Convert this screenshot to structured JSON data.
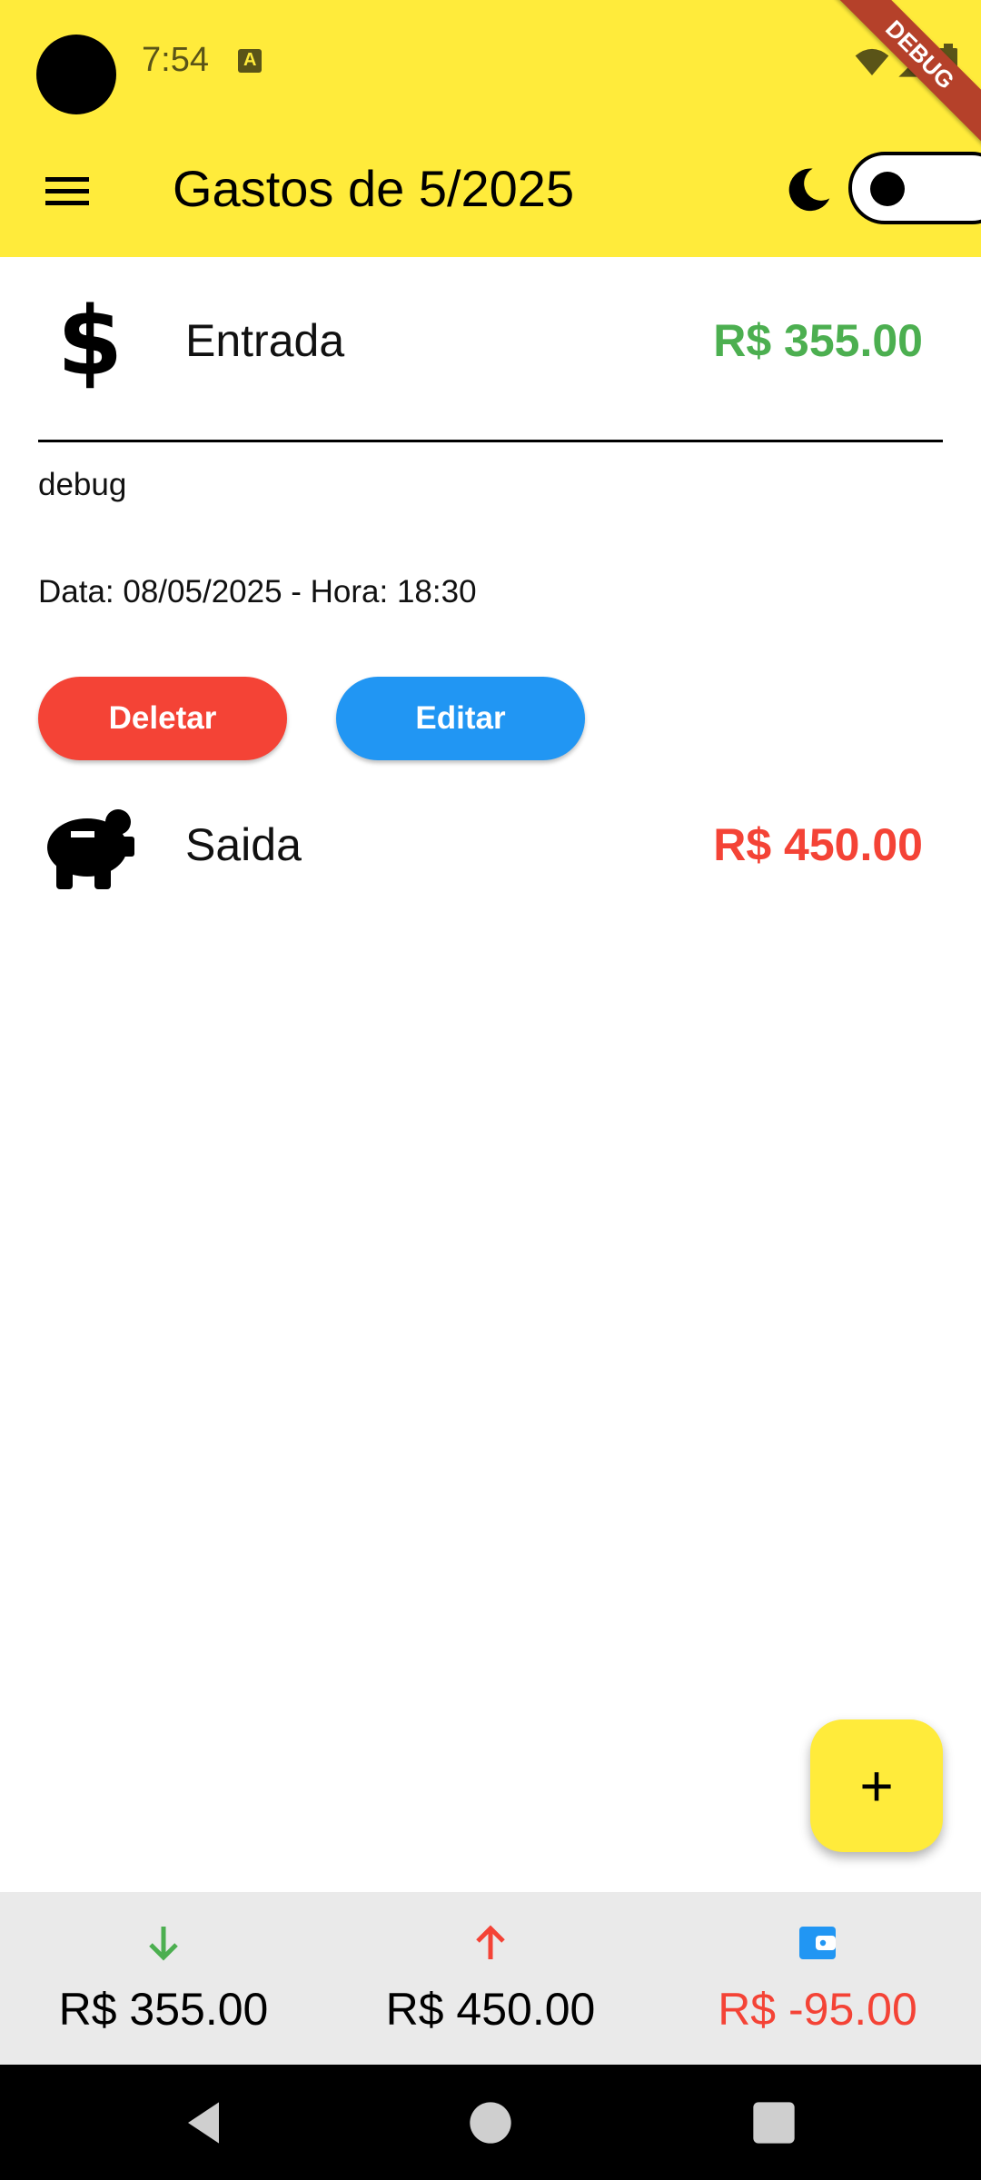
{
  "status_bar": {
    "time": "7:54",
    "debug_label": "DEBUG"
  },
  "app_bar": {
    "title": "Gastos de 5/2025",
    "theme_toggle_on": false
  },
  "transactions": [
    {
      "label": "Entrada",
      "value": "R$ 355.00",
      "icon": "dollar-icon",
      "color": "#4CAF50",
      "expanded": true,
      "description": "debug",
      "datetime": "Data: 08/05/2025 - Hora: 18:30",
      "delete_label": "Deletar",
      "edit_label": "Editar"
    },
    {
      "label": "Saida",
      "value": "R$ 450.00",
      "icon": "piggy-bank-icon",
      "color": "#F44336",
      "expanded": false
    }
  ],
  "fab": {
    "label": "+"
  },
  "summary": {
    "income": {
      "value": "R$ 355.00",
      "icon": "arrow-down-icon",
      "color": "#4CAF50"
    },
    "expense": {
      "value": "R$ 450.00",
      "icon": "arrow-up-icon",
      "color": "#F44336"
    },
    "balance": {
      "value": "R$ -95.00",
      "icon": "wallet-icon",
      "color": "#F44336",
      "icon_color": "#2196F3"
    }
  },
  "colors": {
    "primary": "#FFEB3B",
    "delete": "#F44336",
    "edit": "#2196F3"
  }
}
